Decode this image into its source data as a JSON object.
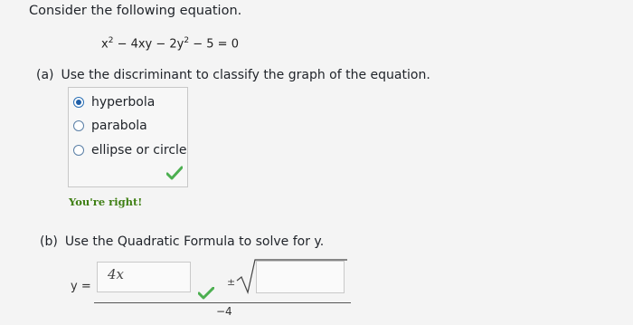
{
  "intro": "Consider the following equation.",
  "equation": {
    "p1": "x",
    "e1": "2",
    "p2": " − 4xy − 2y",
    "e2": "2",
    "p3": " − 5 = 0"
  },
  "part_a": {
    "label": "(a)",
    "question": "Use the discriminant to classify the graph of the equation.",
    "options": [
      "hyperbola",
      "parabola",
      "ellipse or circle"
    ],
    "selected": "hyperbola",
    "feedback": "You're right!"
  },
  "part_b": {
    "label": "(b)",
    "question": "Use the Quadratic Formula to solve for y.",
    "y_label": "y =",
    "numerator_value": "4x",
    "plus_minus": "±",
    "denominator": "−4"
  },
  "colors": {
    "check": "#4caf50",
    "feedback": "#3f7f14",
    "radio_selected": "#1f5fa8"
  }
}
